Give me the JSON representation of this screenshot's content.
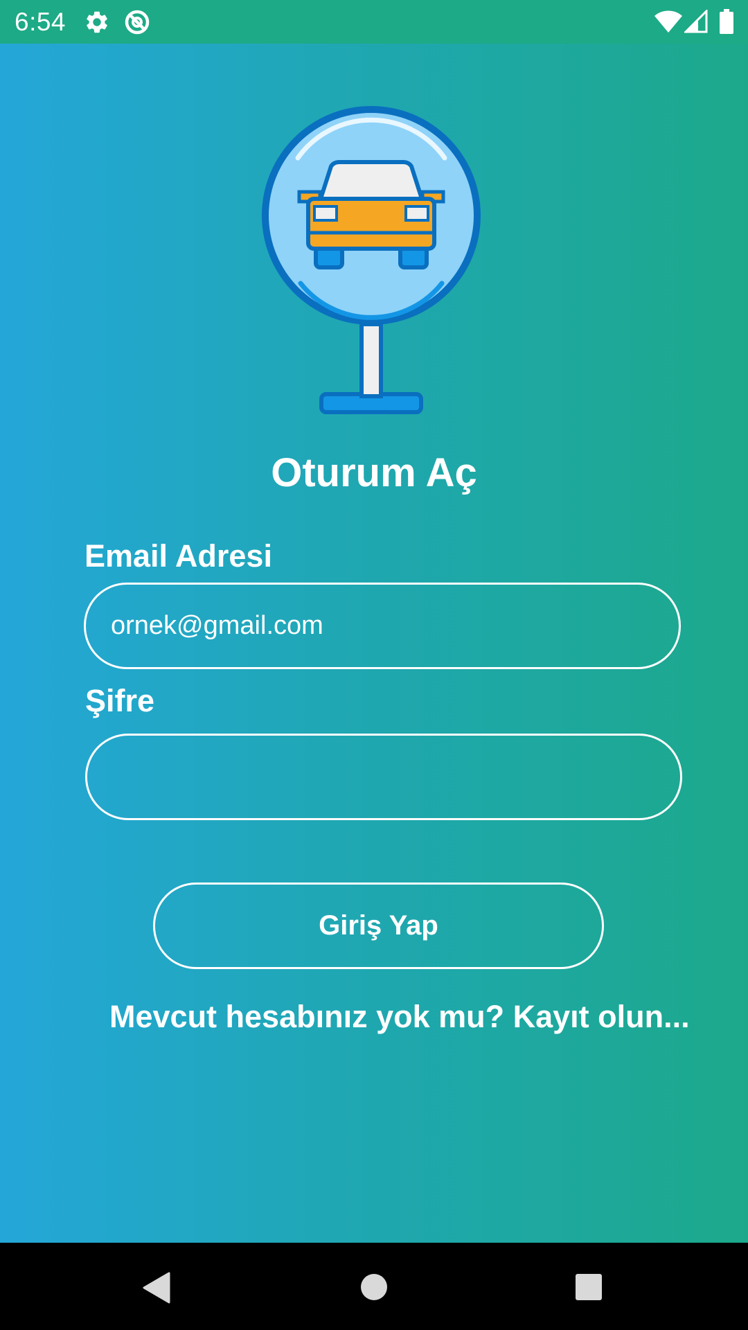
{
  "status_bar": {
    "time": "6:54",
    "icons": [
      "gear-icon",
      "sync-disabled-icon",
      "wifi-icon",
      "signal-icon",
      "battery-icon"
    ],
    "background": "#1daa86"
  },
  "theme": {
    "gradient_start": "#24a7d8",
    "gradient_end": "#1ca98b",
    "text_color": "#ffffff"
  },
  "logo": {
    "icon": "car-sign-icon",
    "colors": {
      "ring": "#0a6fbf",
      "face": "#90d4f8",
      "car_body": "#f5a623",
      "car_window": "#efefef"
    }
  },
  "title": "Oturum Aç",
  "email": {
    "label": "Email Adresi",
    "value": "ornek@gmail.com"
  },
  "password": {
    "label": "Şifre",
    "value": ""
  },
  "login_button": {
    "label": "Giriş Yap"
  },
  "register_link": {
    "label": "Mevcut hesabınız yok mu? Kayıt olun..."
  },
  "nav_bar": {
    "icons": [
      "back-icon",
      "home-icon",
      "recents-icon"
    ]
  }
}
